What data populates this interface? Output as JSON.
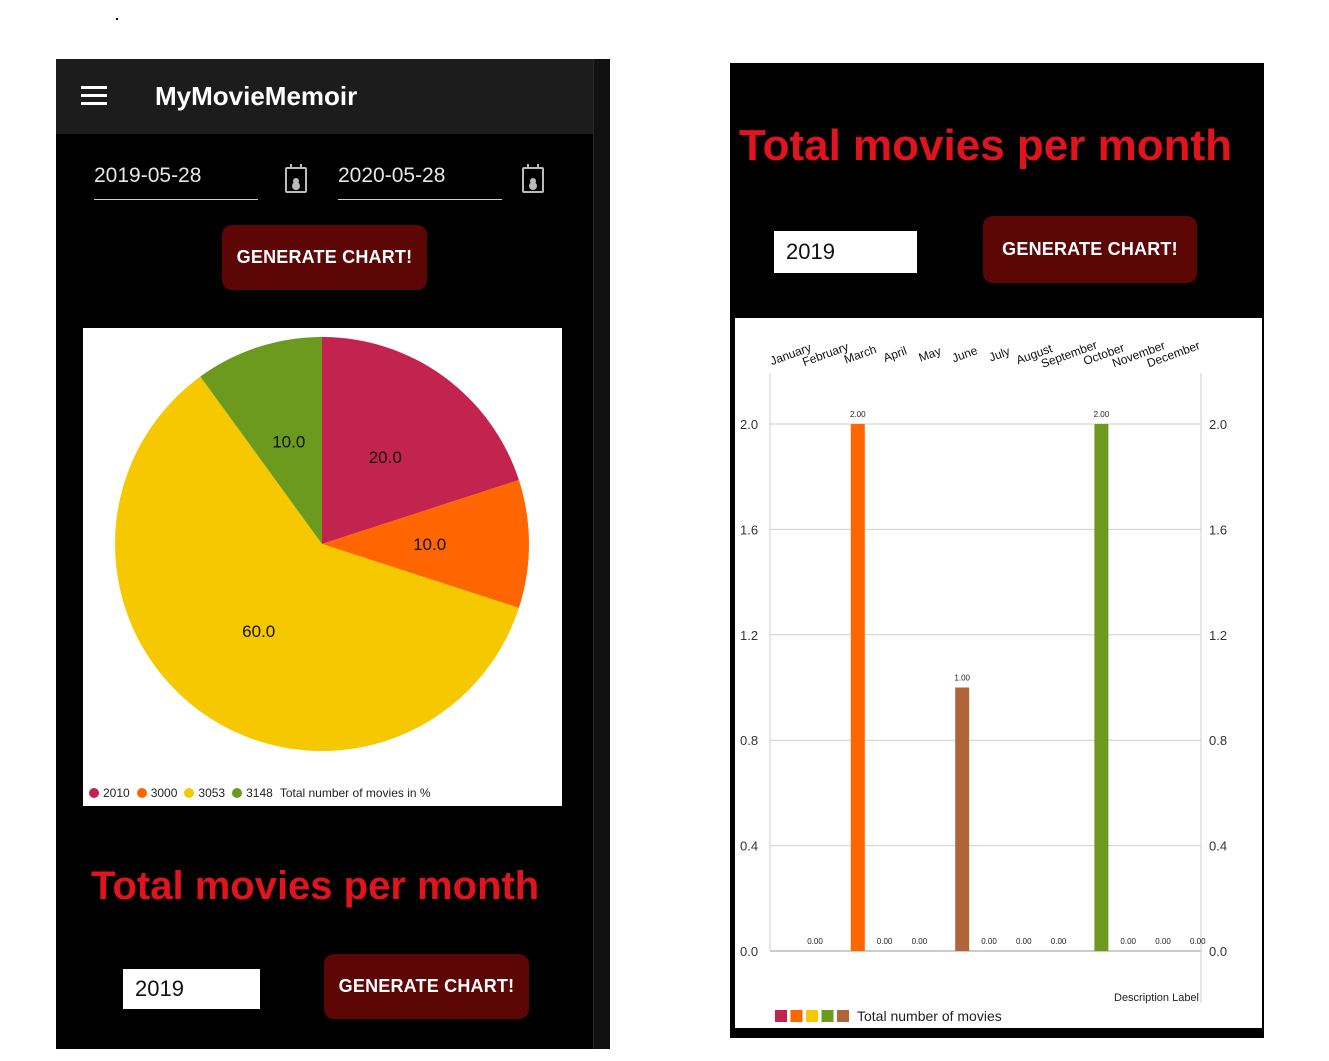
{
  "left_screen": {
    "app_title": "MyMovieMemoir",
    "start_date": "2019-05-28",
    "end_date": "2020-05-28",
    "generate_button": "GENERATE CHART!",
    "monthly_heading": "Total movies per month",
    "year_value": "2019",
    "generate_button_2": "GENERATE CHART!",
    "pie_legend": {
      "items": [
        {
          "label": "2010",
          "color": "#c2244f"
        },
        {
          "label": "3000",
          "color": "#ff6600"
        },
        {
          "label": "3053",
          "color": "#f5c800"
        },
        {
          "label": "3148",
          "color": "#6b9a1e"
        }
      ],
      "description": "Total number of movies in %"
    }
  },
  "right_screen": {
    "heading": "Total movies per month",
    "year_value": "2019",
    "generate_button": "GENERATE CHART!",
    "legend_label": "Total number of movies",
    "description_label": "Description Label",
    "legend_colors": [
      "#c2244f",
      "#ff6600",
      "#f5c800",
      "#6b9a1e",
      "#b0643a"
    ]
  },
  "chart_data": [
    {
      "type": "pie",
      "categories": [
        "2010",
        "3000",
        "3053",
        "3148"
      ],
      "values": [
        20.0,
        10.0,
        60.0,
        10.0
      ],
      "value_labels": [
        "20.0",
        "10.0",
        "60.0",
        "10.0"
      ],
      "colors": [
        "#c2244f",
        "#ff6600",
        "#f5c800",
        "#6b9a1e"
      ],
      "legend_position": "bottom-left"
    },
    {
      "type": "bar",
      "categories": [
        "January",
        "February",
        "March",
        "April",
        "May",
        "June",
        "July",
        "August",
        "September",
        "October",
        "November",
        "December"
      ],
      "values": [
        0,
        2,
        0,
        0,
        1,
        0,
        0,
        0,
        2,
        0,
        0,
        0
      ],
      "value_labels": [
        "0.00",
        "2.00",
        "0.00",
        "0.00",
        "1.00",
        "0.00",
        "0.00",
        "0.00",
        "2.00",
        "0.00",
        "0.00",
        "0.00"
      ],
      "bar_colors": [
        "#c2244f",
        "#ff6600",
        "#f5c800",
        "#6b9a1e",
        "#b0643a",
        "#c2244f",
        "#ff6600",
        "#f5c800",
        "#6b9a1e",
        "#b0643a",
        "#c2244f",
        "#ff6600"
      ],
      "ylim": [
        0,
        2.0
      ],
      "yticks": [
        "0.0",
        "0.4",
        "0.8",
        "1.2",
        "1.6",
        "2.0"
      ],
      "grid": true,
      "xaxis_position": "top"
    }
  ]
}
